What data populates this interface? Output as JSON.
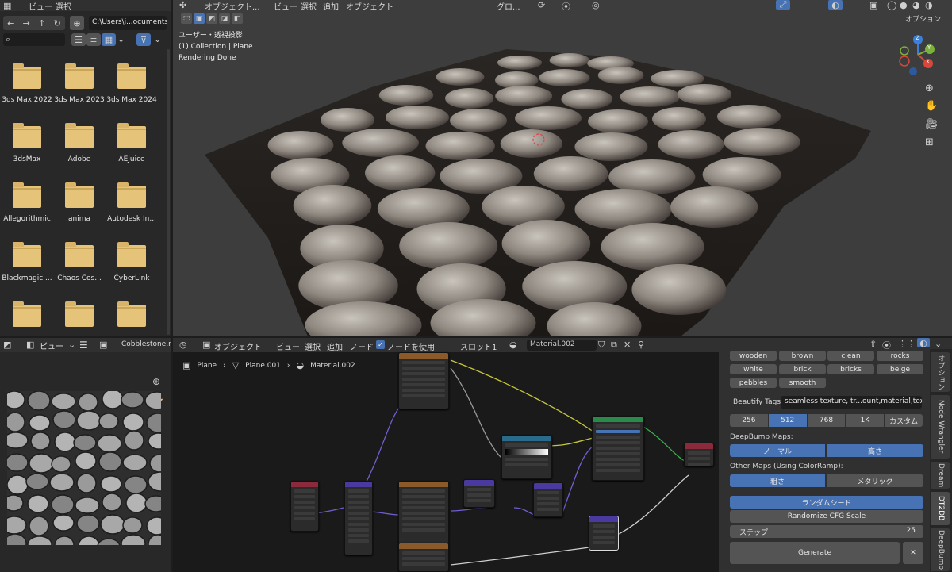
{
  "file_browser": {
    "menu": [
      "ビュー",
      "選択"
    ],
    "path": "C:\\Users\\i...ocuments\\",
    "folders": [
      "3ds Max 2022",
      "3ds Max 2023",
      "3ds Max 2024",
      "3dsMax",
      "Adobe",
      "AEJuice",
      "Allegorithmic",
      "anima",
      "Autodesk In...",
      "Blackmagic ...",
      "Chaos Cos...",
      "CyberLink",
      "",
      "",
      ""
    ]
  },
  "viewport": {
    "mode": "オブジェクト...",
    "menu": [
      "ビュー",
      "選択",
      "追加",
      "オブジェクト"
    ],
    "transform": "グロ...",
    "options": "オプション",
    "overlay_lines": [
      "ユーザー・透視投影",
      "(1) Collection | Plane",
      "Rendering Done"
    ],
    "gizmo_axes": [
      "Z",
      "Y",
      "X"
    ]
  },
  "image_editor": {
    "view": "ビュー",
    "image_name": "Cobblestone,ro"
  },
  "node_editor": {
    "mode": "オブジェクト",
    "menu": [
      "ビュー",
      "選択",
      "追加",
      "ノード"
    ],
    "use_nodes": "ノードを使用",
    "slot": "スロット1",
    "material": "Material.002",
    "breadcrumb": [
      "Plane",
      "Plane.001",
      "Material.002"
    ]
  },
  "panel": {
    "tags": [
      "wooden",
      "brown",
      "clean",
      "rocks",
      "white",
      "brick",
      "bricks",
      "beige",
      "pebbles",
      "smooth"
    ],
    "beautify_label": "Beautify Tags:",
    "beautify_value": "seamless texture, tr...ount,material,texture",
    "sizes": [
      "256",
      "512",
      "768",
      "1K",
      "カスタム"
    ],
    "selected_size": "512",
    "deepbump_label": "DeepBump Maps:",
    "deepbump": [
      "ノーマル",
      "高さ"
    ],
    "other_label": "Other Maps (Using ColorRamp):",
    "other": [
      "粗さ",
      "メタリック"
    ],
    "random_seed": "ランダムシード",
    "randomize_cfg": "Randomize CFG Scale",
    "steps_label": "ステップ",
    "steps_value": "25",
    "generate": "Generate",
    "close": "✕",
    "accent": "#4772b3"
  },
  "vertical_tabs": [
    "オプション",
    "Node Wrangler",
    "Dream",
    "DT2DB",
    "DeepBump"
  ]
}
